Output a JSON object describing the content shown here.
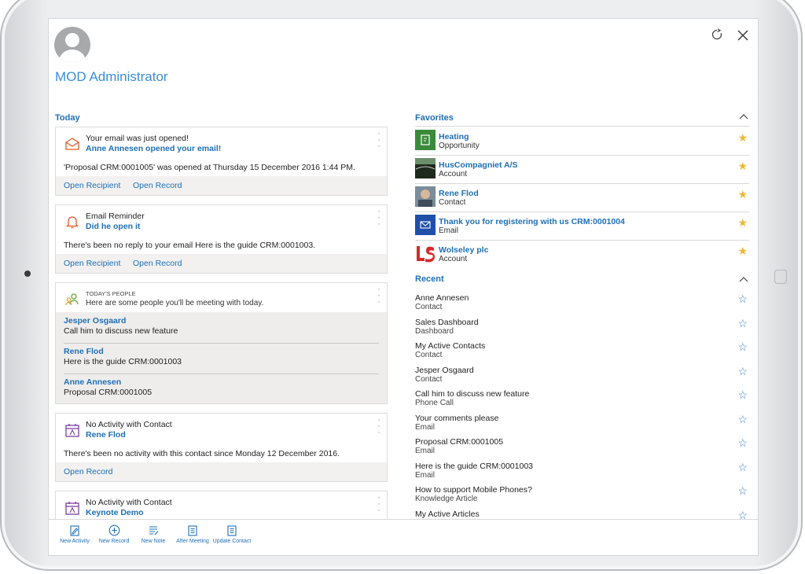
{
  "user": {
    "name": "MOD Administrator"
  },
  "top_icons": {
    "refresh": "refresh-icon",
    "close": "close-icon"
  },
  "today": {
    "heading": "Today",
    "cards": [
      {
        "icon": "open-envelope-icon",
        "title": "Your email was just opened!",
        "subtitle": "Anne Annesen opened your email!",
        "body": "'Proposal CRM:0001005' was opened at Thursday 15 December 2016 1:44 PM.",
        "actions": [
          "Open Recipient",
          "Open Record"
        ]
      },
      {
        "icon": "bell-icon",
        "title": "Email Reminder",
        "subtitle": "Did he open it",
        "body": "There's been no reply to your email Here is the guide CRM:0001003.",
        "actions": [
          "Open Recipient",
          "Open Record"
        ]
      },
      {
        "icon": "people-icon",
        "title": "TODAY'S PEOPLE",
        "subtitle": "Here are some people you'll be meeting with today.",
        "people": [
          {
            "name": "Jesper Osgaard",
            "text": "Call him to discuss new feature"
          },
          {
            "name": "Rene Flod",
            "text": "Here is the guide CRM:0001003"
          },
          {
            "name": "Anne Annesen",
            "text": "Proposal CRM:0001005"
          }
        ]
      },
      {
        "icon": "calendar-icon",
        "title": "No Activity with Contact",
        "subtitle": "Rene Flod",
        "body": "There's been no activity with this contact since Monday 12 December 2016.",
        "actions": [
          "Open Record"
        ]
      },
      {
        "icon": "calendar-icon",
        "title": "No Activity with Contact",
        "subtitle": "Keynote Demo"
      }
    ]
  },
  "favorites": {
    "heading": "Favorites",
    "items": [
      {
        "name": "Heating",
        "type": "Opportunity",
        "thumb_color": "#3a8a3a"
      },
      {
        "name": "HusCompagniet A/S",
        "type": "Account",
        "thumb_color": "#1d2a1d"
      },
      {
        "name": "Rene Flod",
        "type": "Contact",
        "thumb_color": "#7b8c9a"
      },
      {
        "name": "Thank you for registering with us CRM:0001004",
        "type": "Email",
        "thumb_color": "#1f4fa8"
      },
      {
        "name": "Wolseley plc",
        "type": "Account",
        "thumb_color": "#d62a2a"
      }
    ]
  },
  "recent": {
    "heading": "Recent",
    "items": [
      {
        "name": "Anne Annesen",
        "type": "Contact"
      },
      {
        "name": "Sales Dashboard",
        "type": "Dashboard"
      },
      {
        "name": "My Active Contacts",
        "type": "Contact"
      },
      {
        "name": "Jesper Osgaard",
        "type": "Contact"
      },
      {
        "name": "Call him to discuss new feature",
        "type": "Phone Call"
      },
      {
        "name": "Your comments please",
        "type": "Email"
      },
      {
        "name": "Proposal CRM:0001005",
        "type": "Email"
      },
      {
        "name": "Here is the guide CRM:0001003",
        "type": "Email"
      },
      {
        "name": "How to support Mobile Phones?",
        "type": "Knowledge Article"
      },
      {
        "name": "My Active Articles",
        "type": ""
      }
    ]
  },
  "toolbar": {
    "new_activity": "New Activity",
    "new_record": "New Record",
    "new_note": "New Note",
    "after_meeting": "After Meeting",
    "update_contact": "Update Contact"
  }
}
